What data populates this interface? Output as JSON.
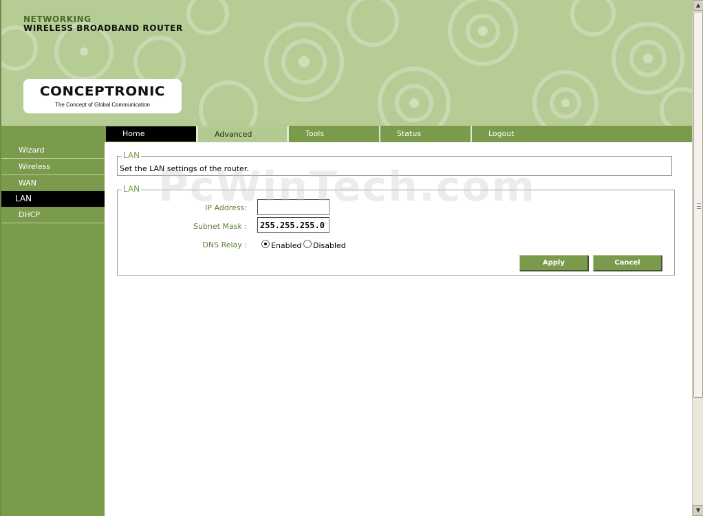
{
  "header": {
    "product_line1": "NETWORKING",
    "product_line2": "WIRELESS BROADBAND ROUTER",
    "logo": {
      "brand": "CONCEPTRONIC",
      "tagline": "The Concept of Global Communication"
    }
  },
  "topnav": {
    "tabs": [
      {
        "label": "Home"
      },
      {
        "label": "Advanced"
      },
      {
        "label": "Tools"
      },
      {
        "label": "Status"
      },
      {
        "label": "Logout"
      }
    ]
  },
  "sidebar": {
    "items": [
      {
        "label": "Wizard"
      },
      {
        "label": "Wireless"
      },
      {
        "label": "WAN"
      },
      {
        "label": "LAN",
        "active": true
      },
      {
        "label": "DHCP"
      }
    ]
  },
  "main": {
    "intro_section": {
      "legend": "LAN",
      "description": "Set the LAN settings of the router."
    },
    "settings_section": {
      "legend": "LAN",
      "ip_address": {
        "label": "IP Address:",
        "value": ""
      },
      "subnet_mask": {
        "label": "Subnet Mask :",
        "value": "255.255.255.0"
      },
      "dns_relay": {
        "label": "DNS Relay :",
        "options": [
          {
            "label": "Enabled",
            "checked": true
          },
          {
            "label": "Disabled",
            "checked": false
          }
        ]
      },
      "apply_label": "Apply",
      "cancel_label": "Cancel"
    }
  },
  "watermark": "PcWinTech.com",
  "colors": {
    "brand_green": "#7a9a4c",
    "header_green": "#b6cc95",
    "label_green": "#5e7d35"
  }
}
